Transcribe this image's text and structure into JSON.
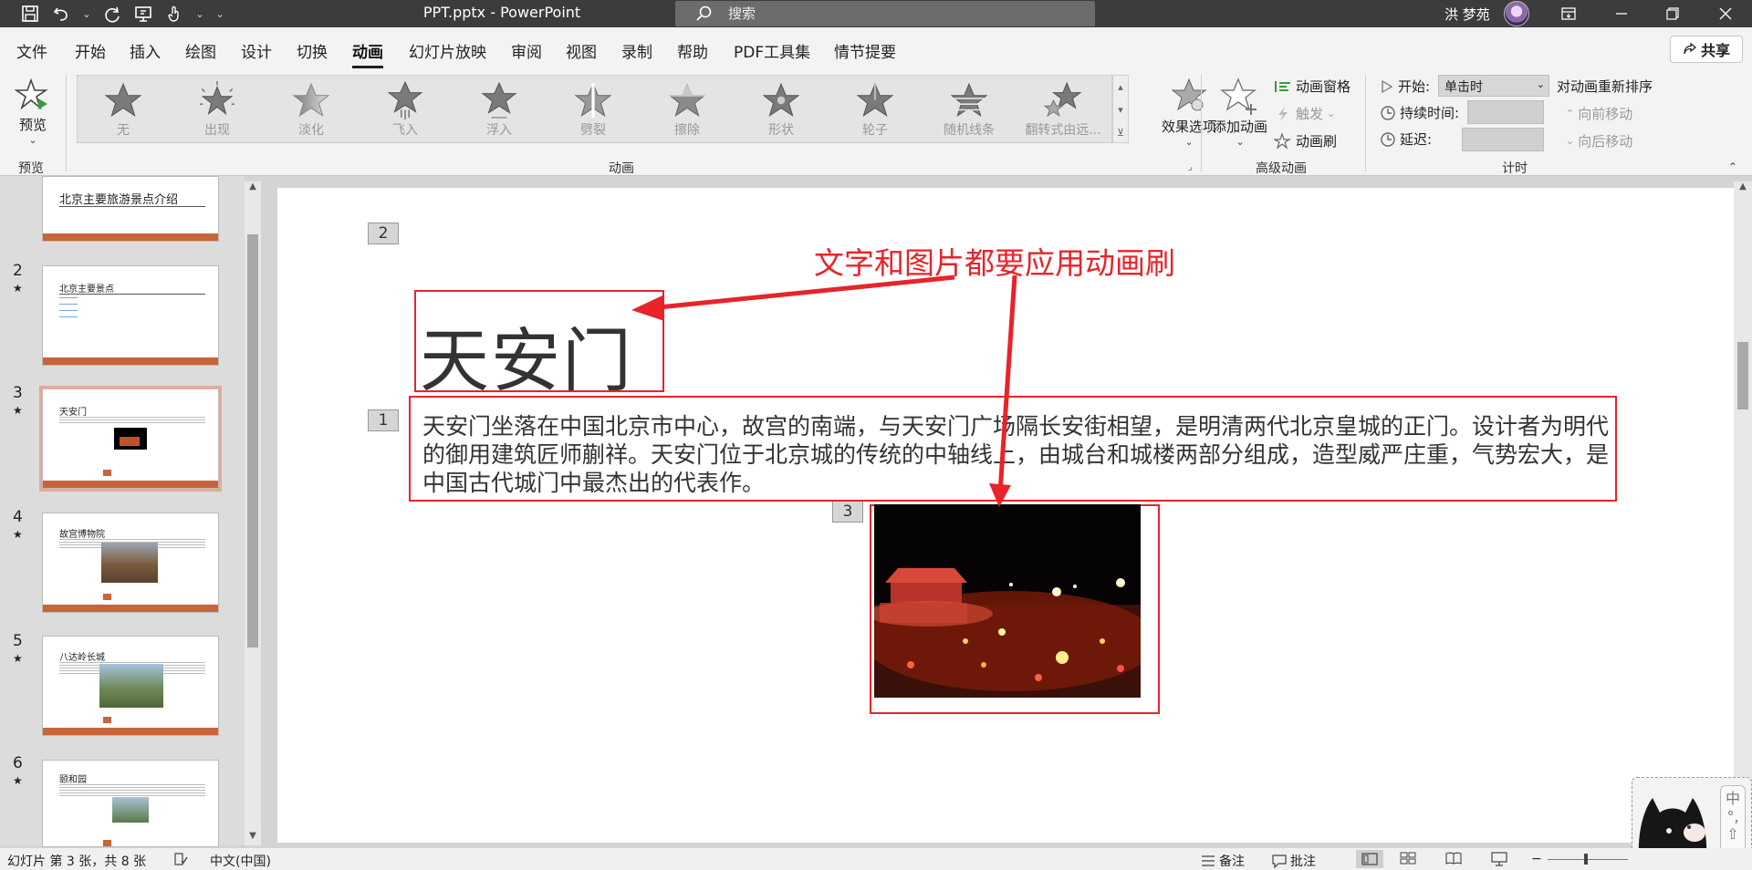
{
  "window": {
    "doc_title": "PPT.pptx  -  PowerPoint",
    "user_name": "洪 梦苑",
    "search": {
      "placeholder": "搜索"
    }
  },
  "tabs": [
    "文件",
    "开始",
    "插入",
    "绘图",
    "设计",
    "切换",
    "动画",
    "幻灯片放映",
    "审阅",
    "视图",
    "录制",
    "帮助",
    "PDF工具集",
    "情节提要"
  ],
  "active_tab": "动画",
  "share_label": "共享",
  "ribbon": {
    "preview": {
      "label": "预览",
      "group": "预览"
    },
    "animations": [
      "无",
      "出现",
      "淡化",
      "飞入",
      "浮入",
      "劈裂",
      "擦除",
      "形状",
      "轮子",
      "随机线条",
      "翻转式由远..."
    ],
    "effect_options": "效果选项",
    "animation_group": "动画",
    "advanced": {
      "add_animation": "添加动画",
      "animation_pane": "动画窗格",
      "trigger": "触发",
      "animation_painter": "动画刷",
      "group": "高级动画"
    },
    "timing": {
      "start_label": "开始:",
      "start_value": "单击时",
      "duration_label": "持续时间:",
      "delay_label": "延迟:",
      "reorder_label": "对动画重新排序",
      "move_earlier": "向前移动",
      "move_later": "向后移动",
      "group": "计时"
    }
  },
  "thumbnails": [
    {
      "num": "",
      "title": "北京主要旅游景点介绍",
      "star": ""
    },
    {
      "num": "2",
      "title": "北京主要景点",
      "star": "★"
    },
    {
      "num": "3",
      "title": "天安门",
      "star": "★"
    },
    {
      "num": "4",
      "title": "故宫博物院",
      "star": "★"
    },
    {
      "num": "5",
      "title": "八达岭长城",
      "star": "★"
    },
    {
      "num": "6",
      "title": "颐和园",
      "star": "★"
    }
  ],
  "slide": {
    "title": "天安门",
    "body": "天安门坐落在中国北京市中心，故宫的南端，与天安门广场隔长安街相望，是明清两代北京皇城的正门。设计者为明代的御用建筑匠师蒯祥。天安门位于北京城的传统的中轴线上，由城台和城楼两部分组成，造型威严庄重，气势宏大，是中国古代城门中最杰出的代表作。",
    "tags": [
      "2",
      "1",
      "3"
    ],
    "annotation": "文字和图片都要应用动画刷"
  },
  "sticker": {
    "chars": [
      "中",
      "°,",
      "⇧"
    ]
  },
  "status": {
    "slide_info": "幻灯片 第 3 张，共 8 张",
    "language": "中文(中国)",
    "notes": "备注",
    "comments": "批注"
  }
}
